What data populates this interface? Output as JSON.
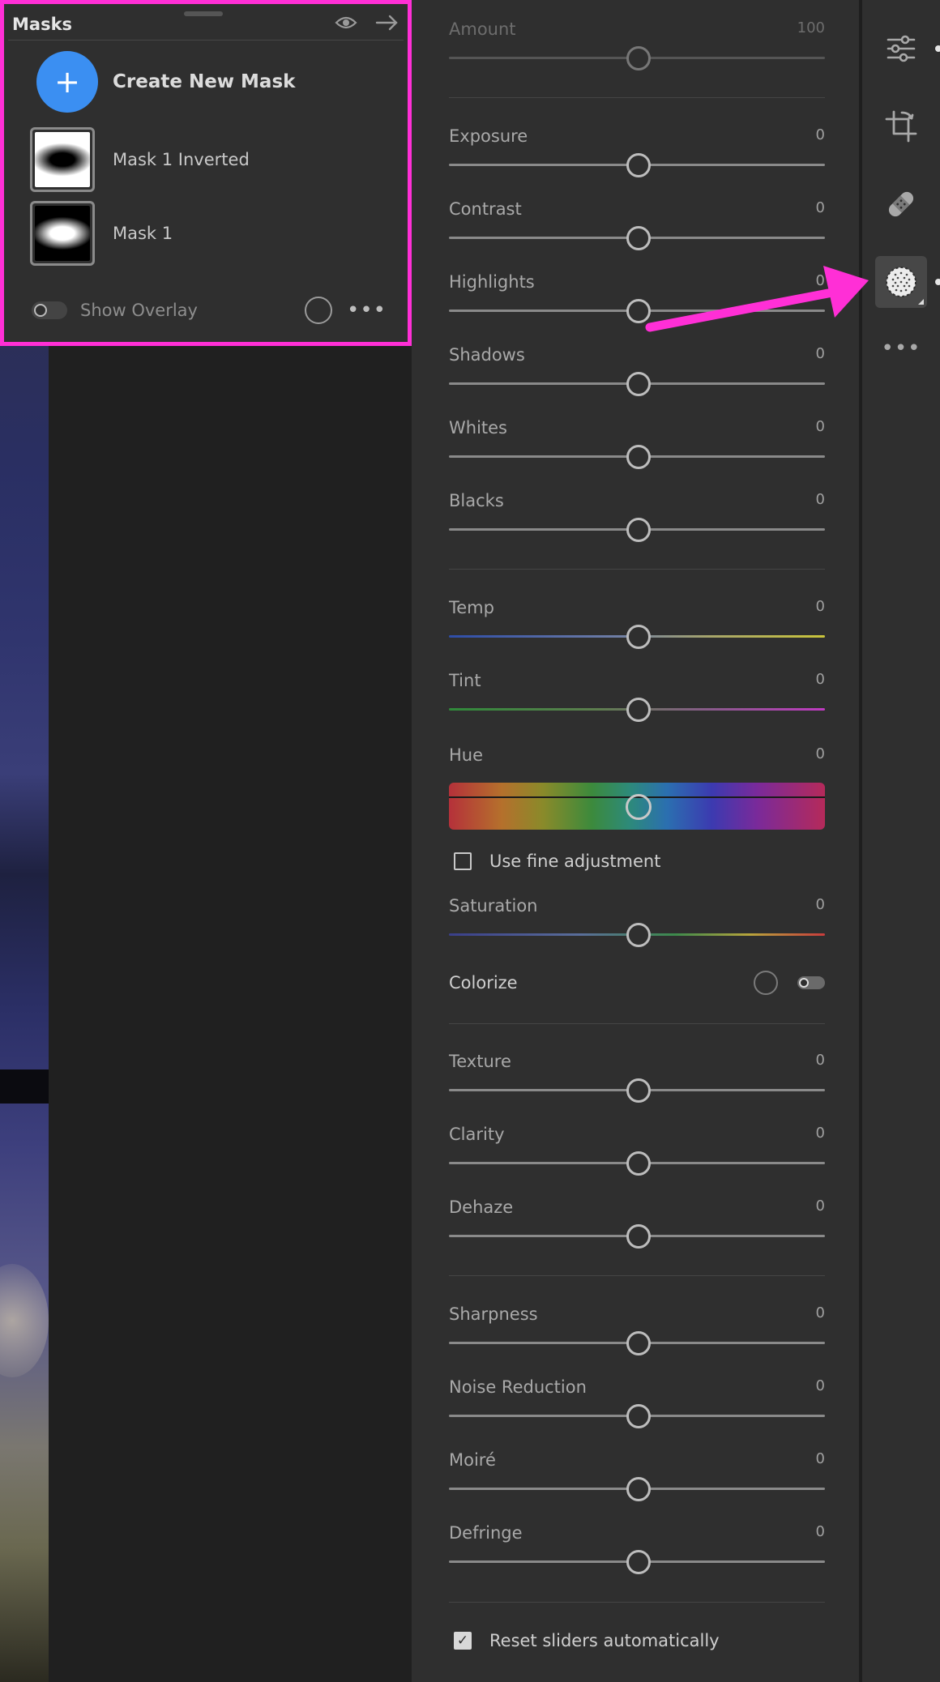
{
  "masks_panel": {
    "title": "Masks",
    "create_label": "Create New Mask",
    "masks": [
      {
        "name": "Mask 1 Inverted"
      },
      {
        "name": "Mask 1"
      }
    ],
    "show_overlay_label": "Show Overlay"
  },
  "adjustments": {
    "amount": {
      "label": "Amount",
      "value": "100"
    },
    "light": [
      {
        "label": "Exposure",
        "value": "0"
      },
      {
        "label": "Contrast",
        "value": "0"
      },
      {
        "label": "Highlights",
        "value": "0"
      },
      {
        "label": "Shadows",
        "value": "0"
      },
      {
        "label": "Whites",
        "value": "0"
      },
      {
        "label": "Blacks",
        "value": "0"
      }
    ],
    "color": {
      "temp": {
        "label": "Temp",
        "value": "0"
      },
      "tint": {
        "label": "Tint",
        "value": "0"
      },
      "hue": {
        "label": "Hue",
        "value": "0"
      },
      "fine_adjustment_label": "Use fine adjustment",
      "saturation": {
        "label": "Saturation",
        "value": "0"
      },
      "colorize_label": "Colorize"
    },
    "effects": [
      {
        "label": "Texture",
        "value": "0"
      },
      {
        "label": "Clarity",
        "value": "0"
      },
      {
        "label": "Dehaze",
        "value": "0"
      }
    ],
    "detail": [
      {
        "label": "Sharpness",
        "value": "0"
      },
      {
        "label": "Noise Reduction",
        "value": "0"
      },
      {
        "label": "Moiré",
        "value": "0"
      },
      {
        "label": "Defringe",
        "value": "0"
      }
    ],
    "reset_label": "Reset sliders automatically",
    "reset_checked": true,
    "fine_adjustment_checked": false
  },
  "toolbar": {
    "tools": [
      "edit-sliders-icon",
      "crop-rotate-icon",
      "healing-bandage-icon",
      "masking-icon",
      "more-icon"
    ],
    "active_tool": "masking-icon"
  },
  "colors": {
    "highlight": "#ff2fd6",
    "accent": "#3b8ff2"
  }
}
